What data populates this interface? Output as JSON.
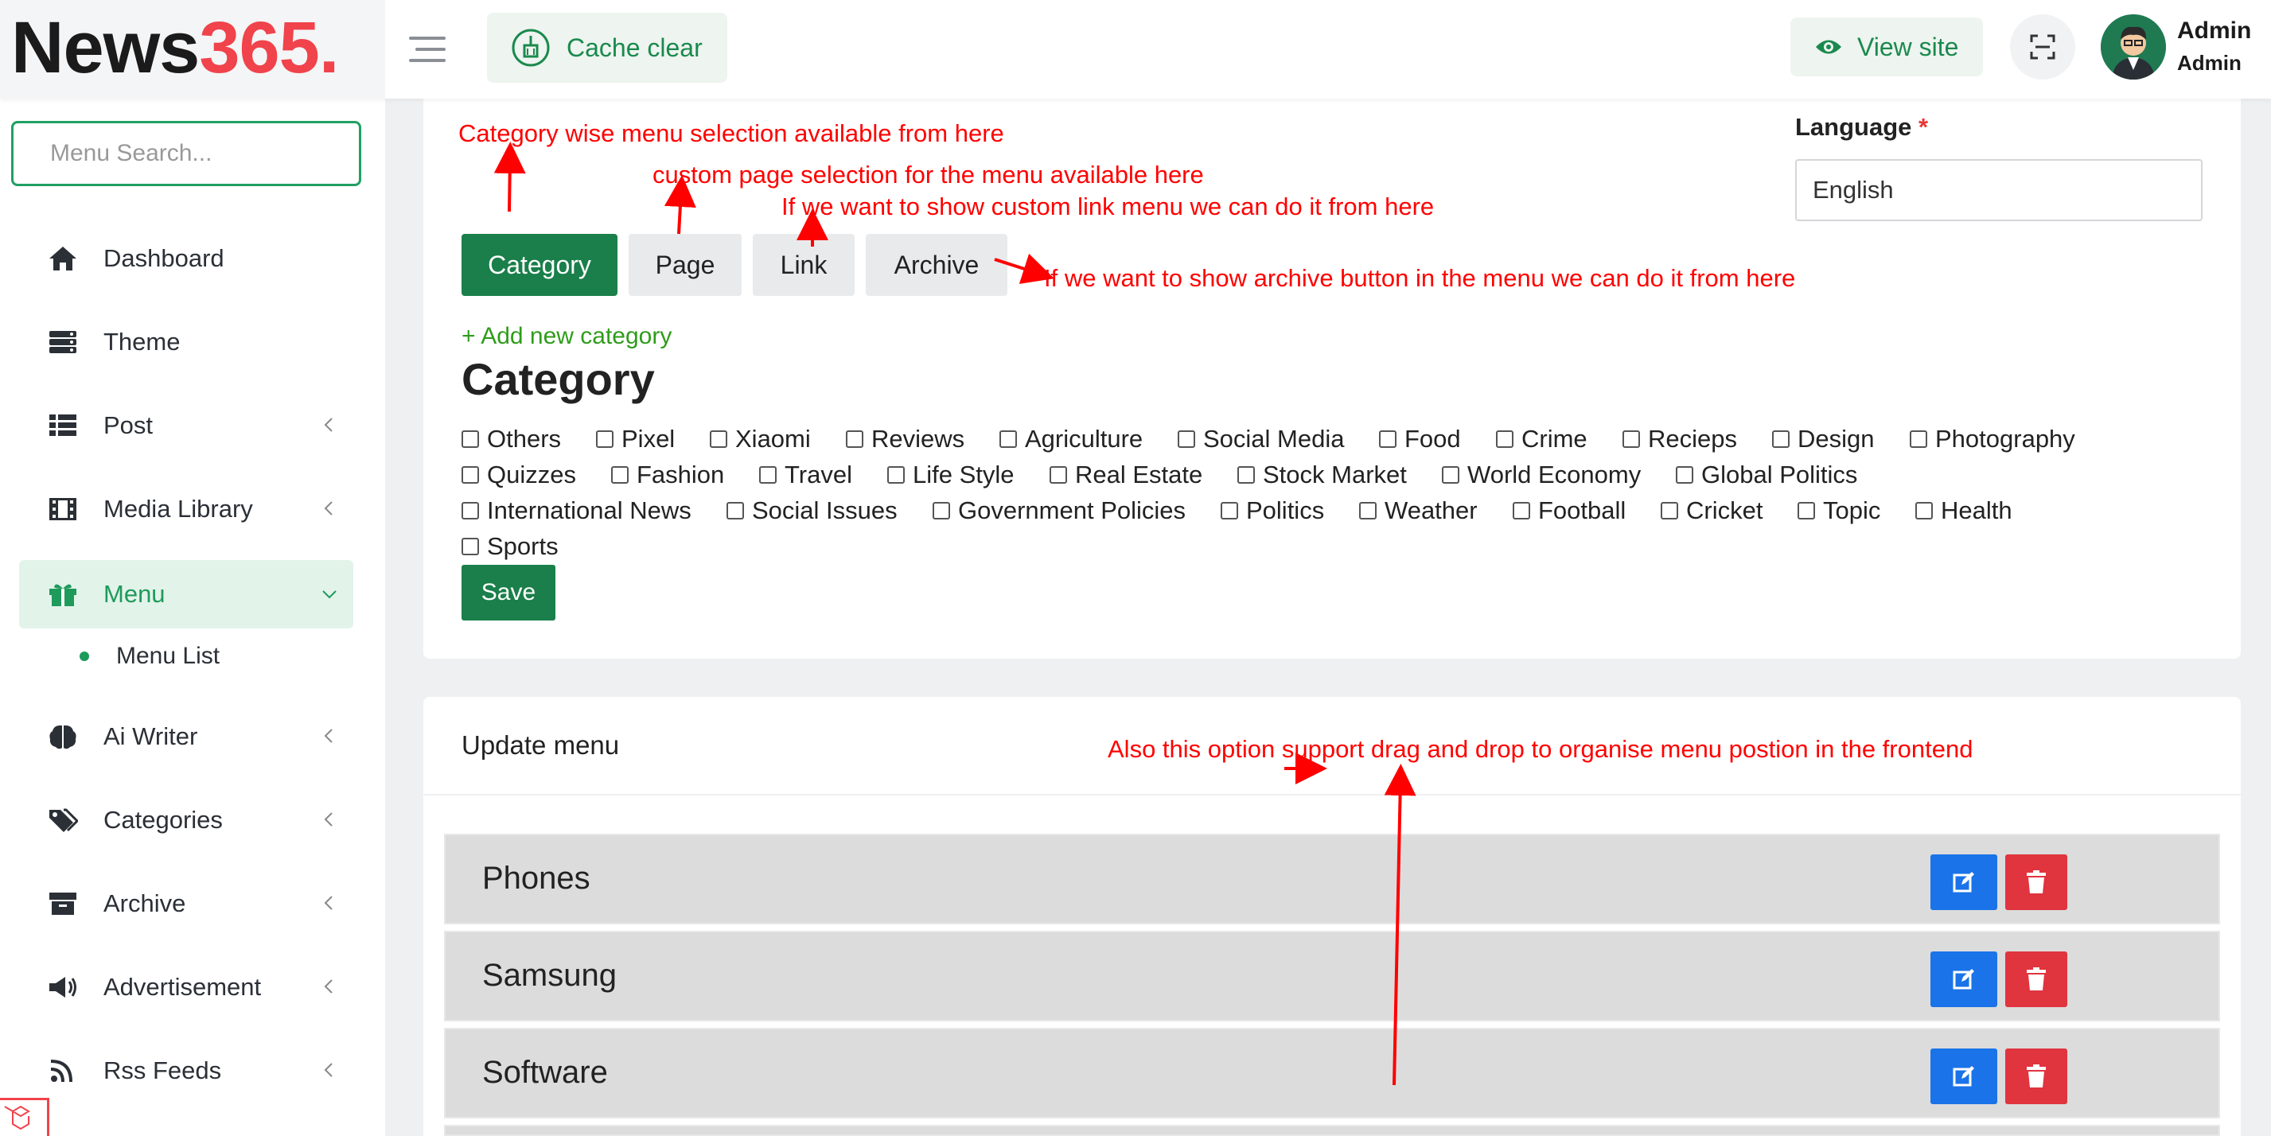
{
  "header": {
    "logo_part1": "News",
    "logo_part2": "365.",
    "cache_label": "Cache clear",
    "view_site_label": "View site",
    "admin_name": "Admin",
    "admin_role": "Admin"
  },
  "sidebar": {
    "search_placeholder": "Menu Search...",
    "items": [
      {
        "label": "Dashboard",
        "icon": "home-icon"
      },
      {
        "label": "Theme",
        "icon": "layers-icon"
      },
      {
        "label": "Post",
        "icon": "list-icon"
      },
      {
        "label": "Media Library",
        "icon": "film-icon"
      },
      {
        "label": "Menu",
        "icon": "gift-icon"
      },
      {
        "label": "Ai Writer",
        "icon": "brain-icon"
      },
      {
        "label": "Categories",
        "icon": "tags-icon"
      },
      {
        "label": "Archive",
        "icon": "archive-icon"
      },
      {
        "label": "Advertisement",
        "icon": "megaphone-icon"
      },
      {
        "label": "Rss Feeds",
        "icon": "rss-icon"
      }
    ],
    "submenu_label": "Menu List"
  },
  "tabs": [
    "Category",
    "Page",
    "Link",
    "Archive"
  ],
  "language": {
    "label": "Language",
    "required_mark": "*",
    "value": "English"
  },
  "category_section": {
    "add_new": "+ Add new category",
    "heading": "Category",
    "checkboxes": [
      "Others",
      "Pixel",
      "Xiaomi",
      "Reviews",
      "Agriculture",
      "Social Media",
      "Food",
      "Crime",
      "Recieps",
      "Design",
      "Photography",
      "Quizzes",
      "Fashion",
      "Travel",
      "Life Style",
      "Real Estate",
      "Stock Market",
      "World Economy",
      "Global Politics",
      "International News",
      "Social Issues",
      "Government Policies",
      "Politics",
      "Weather",
      "Football",
      "Cricket",
      "Topic",
      "Health",
      "Sports"
    ],
    "save_label": "Save"
  },
  "update_menu": {
    "title": "Update menu",
    "rows": [
      "Phones",
      "Samsung",
      "Software"
    ]
  },
  "annotations": {
    "a1": "Category wise menu selection available from here",
    "a2": "custom page selection for the menu available here",
    "a3": "If we want to show custom link menu we can do it from here",
    "a4": "If we want to show archive button in the menu we can do it from here",
    "a5": "Also this option support drag and drop to organise menu postion in the frontend"
  },
  "colors": {
    "brand_green": "#1a7f4a",
    "logo_red": "#f0434b",
    "annotation_red": "#ff0000",
    "edit_blue": "#1a73e8",
    "delete_red": "#e0343f"
  }
}
